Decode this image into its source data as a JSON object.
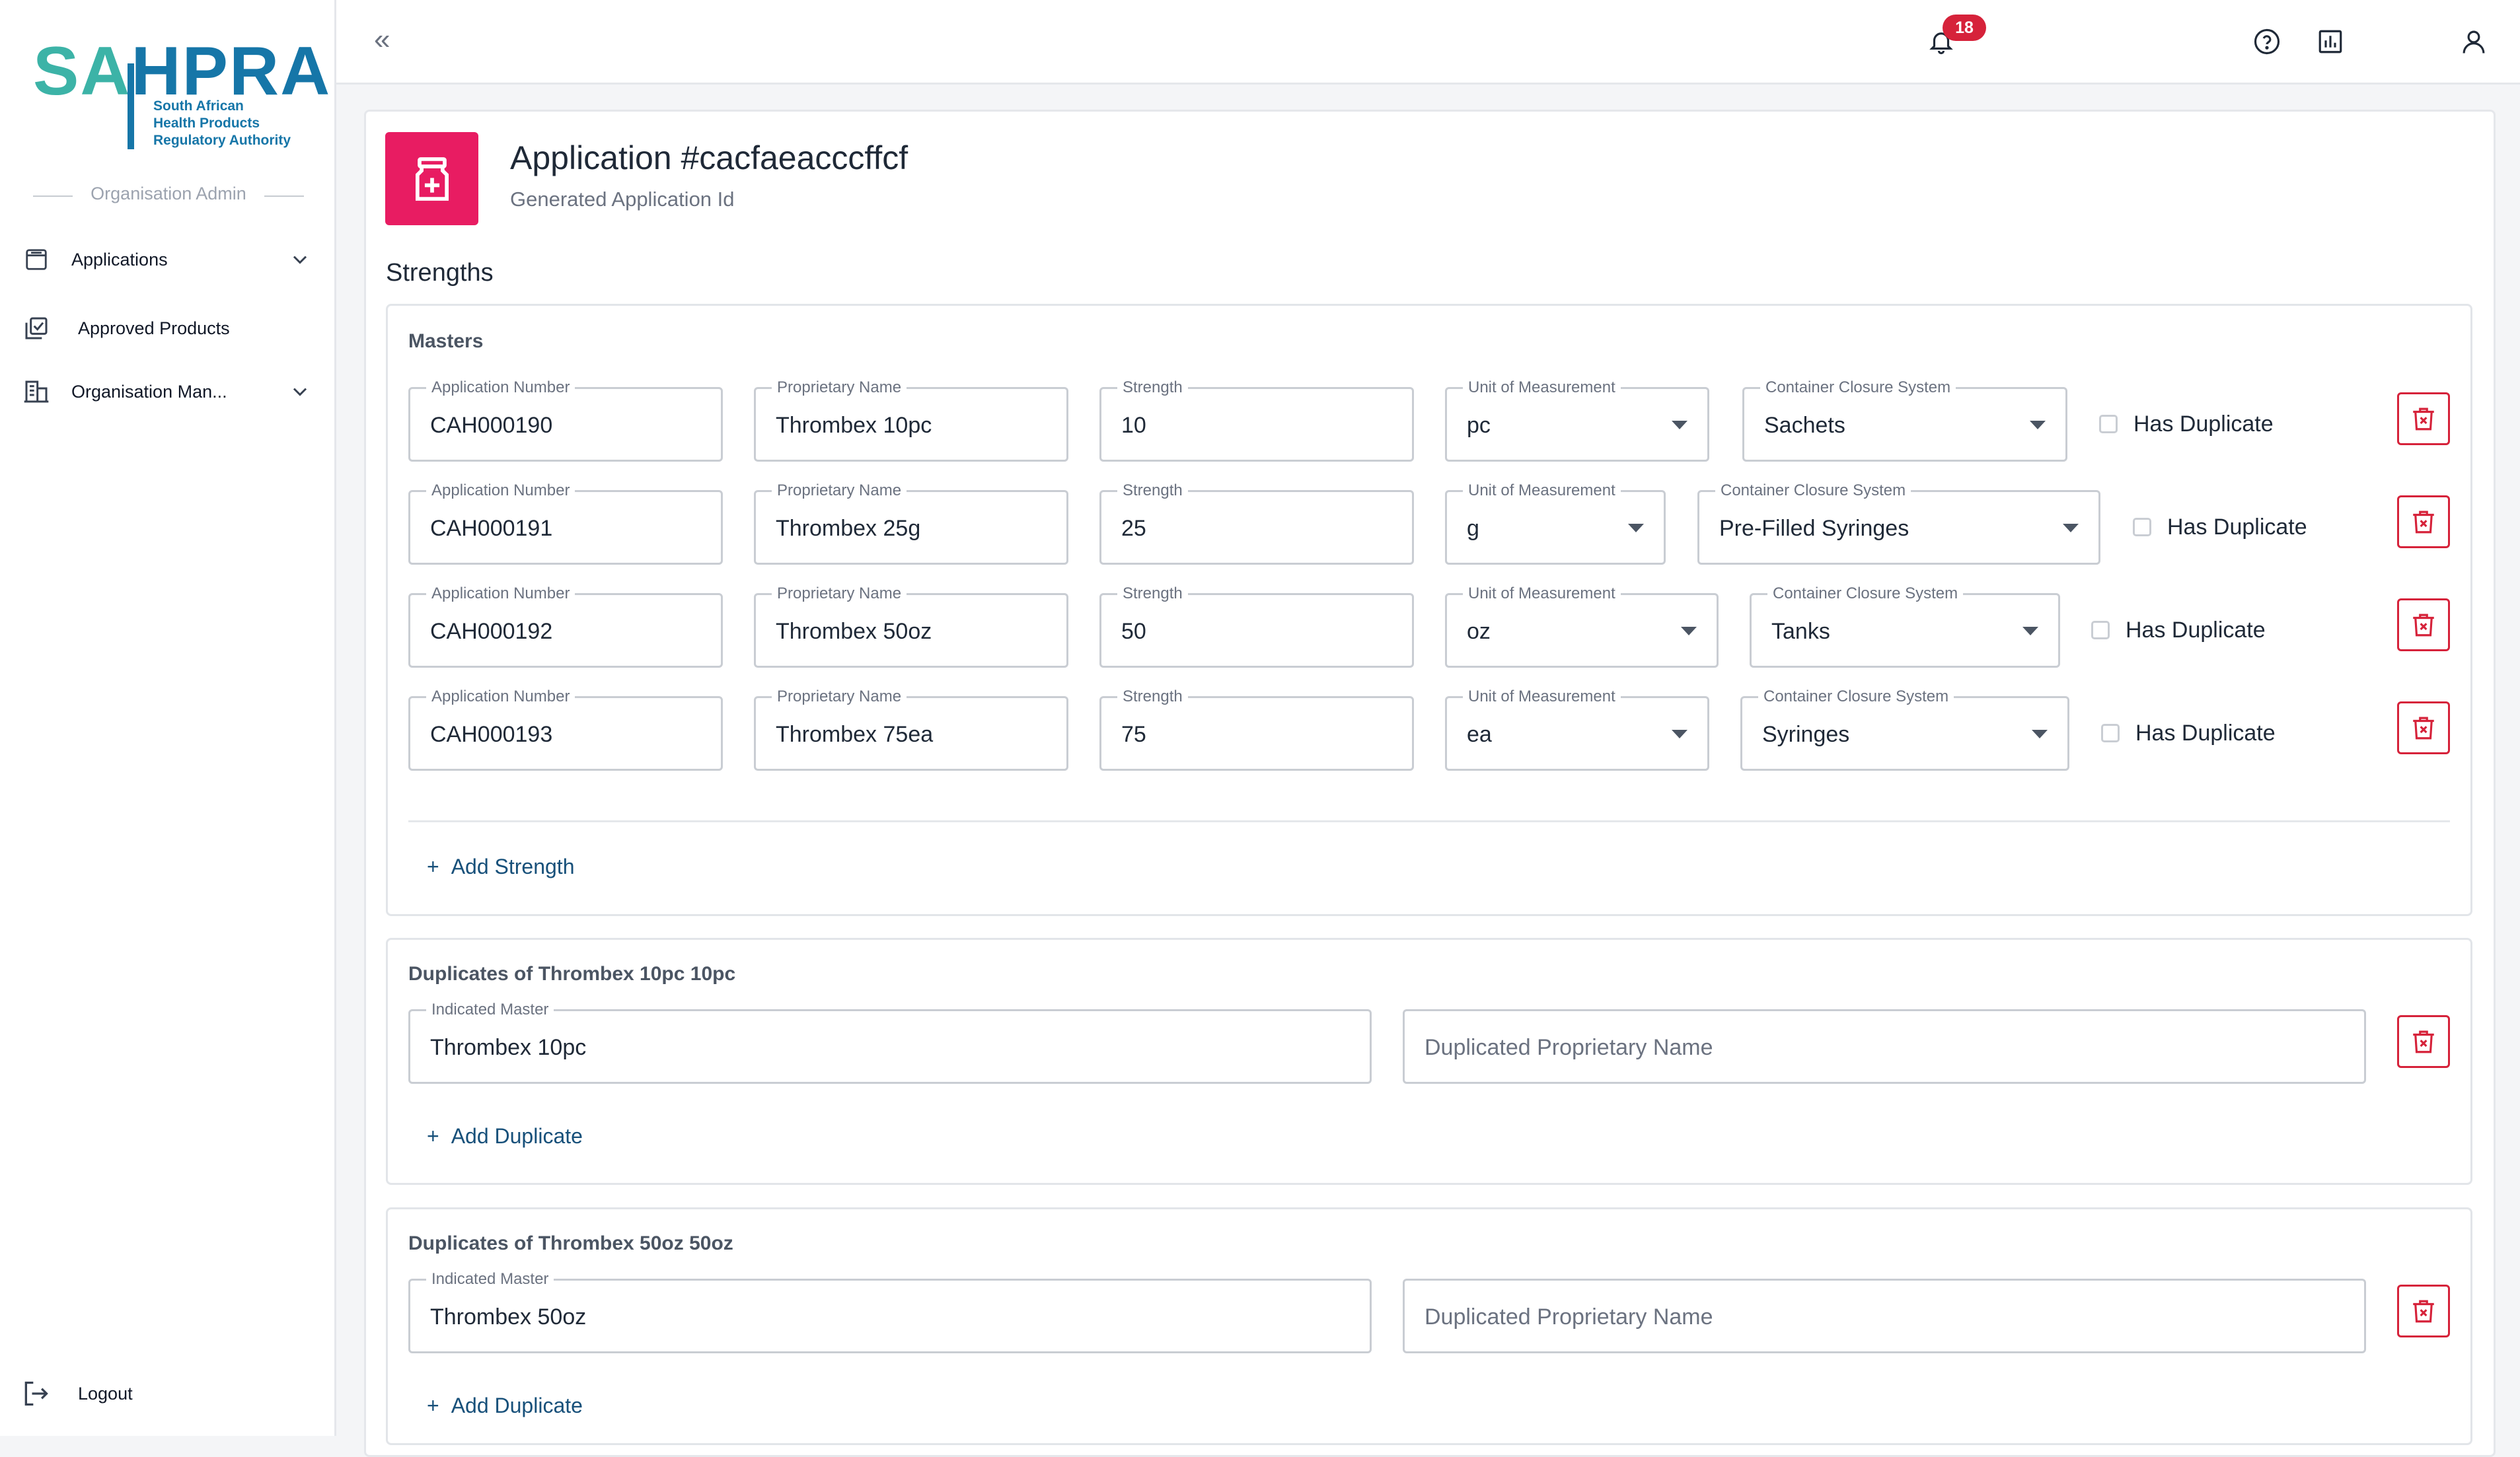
{
  "brand": {
    "logo_text_a": "SA",
    "logo_text_b": "HPRA",
    "logo_sub_1": "South African",
    "logo_sub_2": "Health Products",
    "logo_sub_3": "Regulatory Authority",
    "colors": {
      "teal": "#3cb3a7",
      "blue": "#1676a8",
      "accent": "#e81c62",
      "danger": "#d6223a",
      "link": "#17507a"
    }
  },
  "sidebar": {
    "role": "Organisation Admin",
    "items": [
      {
        "label": "Applications",
        "icon": "applications-icon",
        "expandable": true
      },
      {
        "label": "Approved Products",
        "icon": "approved-products-icon",
        "expandable": false
      },
      {
        "label": "Organisation Man...",
        "icon": "organisation-icon",
        "expandable": true
      }
    ],
    "logout_label": "Logout"
  },
  "topbar": {
    "collapse_glyph": "«",
    "icons": [
      "help-icon",
      "reports-icon",
      "notifications-icon",
      "user-icon"
    ],
    "notification_count": "18"
  },
  "application": {
    "title": "Application #cacfaeacccffcf",
    "subtitle": "Generated Application Id",
    "icon": "medicine-bottle-icon"
  },
  "strengths": {
    "section_title": "Strengths",
    "masters_title": "Masters",
    "labels": {
      "app_number": "Application Number",
      "proprietary_name": "Proprietary Name",
      "strength": "Strength",
      "unit": "Unit of Measurement",
      "container": "Container Closure System",
      "has_duplicate": "Has Duplicate"
    },
    "rows": [
      {
        "app_number": "CAH000190",
        "proprietary_name": "Thrombex 10pc",
        "strength": "10",
        "unit": "pc",
        "container": "Sachets",
        "has_duplicate": false
      },
      {
        "app_number": "CAH000191",
        "proprietary_name": "Thrombex 25g",
        "strength": "25",
        "unit": "g",
        "container": "Pre-Filled Syringes",
        "has_duplicate": false
      },
      {
        "app_number": "CAH000192",
        "proprietary_name": "Thrombex 50oz",
        "strength": "50",
        "unit": "oz",
        "container": "Tanks",
        "has_duplicate": false
      },
      {
        "app_number": "CAH000193",
        "proprietary_name": "Thrombex 75ea",
        "strength": "75",
        "unit": "ea",
        "container": "Syringes",
        "has_duplicate": false
      }
    ],
    "add_strength_label": "Add Strength"
  },
  "duplicates": [
    {
      "title": "Duplicates of Thrombex 10pc 10pc",
      "indicated_master_label": "Indicated Master",
      "indicated_master": "Thrombex 10pc",
      "dup_name_placeholder": "Duplicated Proprietary Name",
      "add_label": "Add Duplicate"
    },
    {
      "title": "Duplicates of Thrombex 50oz 50oz",
      "indicated_master_label": "Indicated Master",
      "indicated_master": "Thrombex 50oz",
      "dup_name_placeholder": "Duplicated Proprietary Name",
      "add_label": "Add Duplicate"
    }
  ]
}
